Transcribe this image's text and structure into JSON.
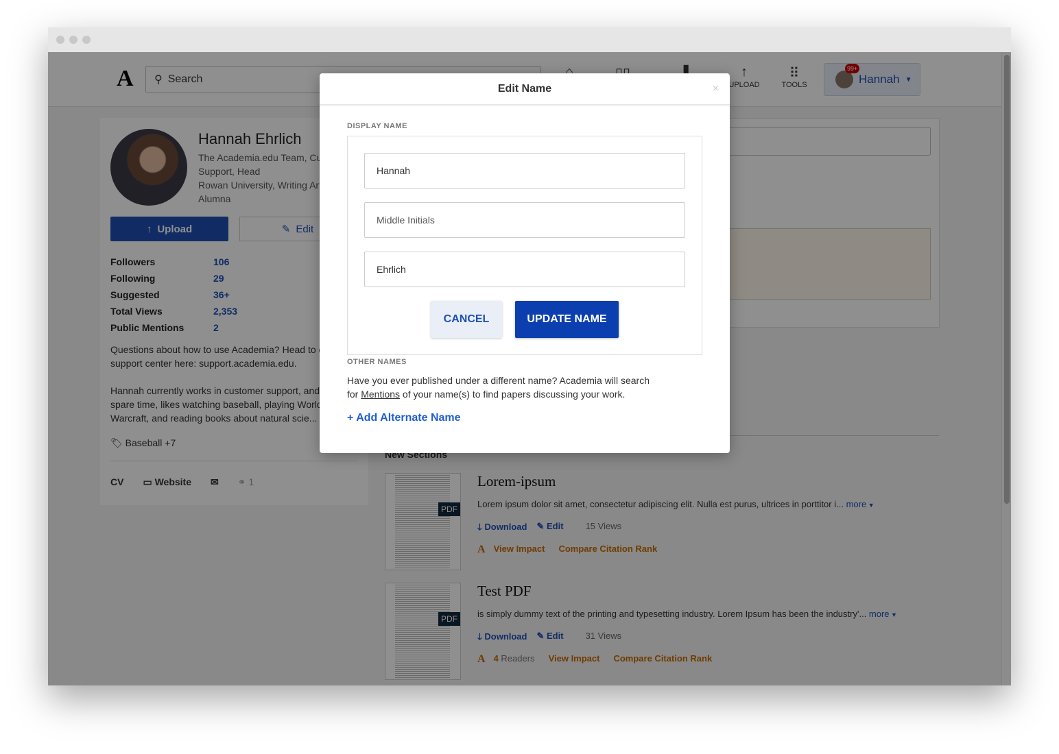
{
  "nav": {
    "logo": "A",
    "search_placeholder": "Search",
    "upload": "UPLOAD",
    "tools": "TOOLS",
    "user": "Hannah",
    "notif_badge": "99+"
  },
  "profile": {
    "name": "Hannah Ehrlich",
    "affiliation": "The Academia.edu Team, Customer Support, Head",
    "affiliation2": "Rowan University, Writing Arts, Alumna",
    "upload": "Upload",
    "edit": "Edit",
    "stats": [
      {
        "label": "Followers",
        "value": "106"
      },
      {
        "label": "Following",
        "value": "29"
      },
      {
        "label": "Suggested",
        "value": "36+"
      },
      {
        "label": "Total Views",
        "value": "2,353"
      },
      {
        "label": "Public Mentions",
        "value": "2"
      }
    ],
    "bio1": "Questions about how to use Academia? Head to our support center here: support.academia.edu.",
    "bio2": "Hannah currently works in customer support, and in her spare time, likes watching baseball, playing World of Warcraft, and reading books about natural scie...",
    "tags": "Baseball +7",
    "cv": "CV",
    "website": "Website",
    "links_count": "1"
  },
  "section_title": "New Sections",
  "papers": [
    {
      "title": "Lorem-ipsum",
      "desc": "Lorem ipsum dolor sit amet, consectetur adipiscing elit. Nulla est purus, ultrices in porttitor i...",
      "more": "more",
      "download": "Download",
      "edit": "Edit",
      "views": "15 Views",
      "readers_count": "",
      "readers": "",
      "impact": "View Impact",
      "rank": "Compare Citation Rank"
    },
    {
      "title": "Test PDF",
      "desc": "is simply dummy text of the printing and typesetting industry. Lorem Ipsum has been the industry'...",
      "more": "more",
      "download": "Download",
      "edit": "Edit",
      "views": "31 Views",
      "readers_count": "4",
      "readers": "Readers",
      "impact": "View Impact",
      "rank": "Compare Citation Rank"
    }
  ],
  "modal": {
    "title": "Edit Name",
    "close": "×",
    "display_name_label": "DISPLAY NAME",
    "first": "Hannah",
    "middle_placeholder": "Middle Initials",
    "last": "Ehrlich",
    "cancel": "CANCEL",
    "update": "UPDATE NAME",
    "other_names_label": "OTHER NAMES",
    "other_text_1": "Have you ever published under a different name? Academia will search for ",
    "mentions": "Mentions",
    "other_text_2": " of your name(s) to find papers discussing your work.",
    "add_alt": "+ Add Alternate Name"
  }
}
